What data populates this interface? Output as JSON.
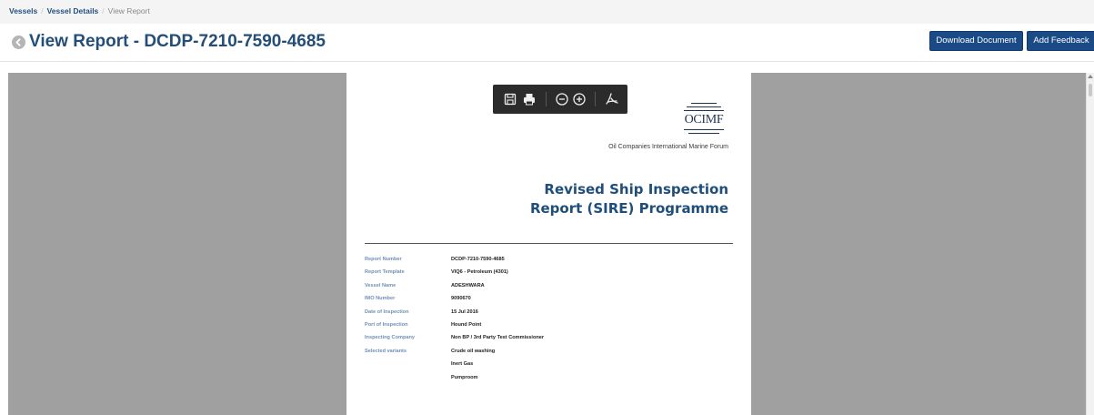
{
  "breadcrumb": {
    "items": [
      "Vessels",
      "Vessel Details"
    ],
    "current": "View Report",
    "separator": "/"
  },
  "header": {
    "title": "View Report - DCDP-7210-7590-4685",
    "download_label": "Download Document",
    "feedback_label": "Add Feedback"
  },
  "viewer_toolbar": {
    "icons": [
      "save-icon",
      "print-icon",
      "zoom-out-icon",
      "zoom-in-icon",
      "pdf-icon"
    ]
  },
  "document": {
    "logo_text": "OCIMF",
    "forum_name": "Oil Companies International Marine Forum",
    "title_line1": "Revised Ship Inspection",
    "title_line2": "Report (SIRE) Programme",
    "details": [
      {
        "label": "Report Number",
        "value": "DCDP-7210-7590-4685"
      },
      {
        "label": "Report Template",
        "value": "VIQ6 - Petroleum (4301)"
      },
      {
        "label": "Vessel Name",
        "value": "ADESHWARA"
      },
      {
        "label": "IMO Number",
        "value": "9090670"
      },
      {
        "label": "Date of Inspection",
        "value": "15 Jul 2016"
      },
      {
        "label": "Port of Inspection",
        "value": "Hound Point"
      },
      {
        "label": "Inspecting Company",
        "value": "Non BP / 3rd Party Test Commissioner"
      },
      {
        "label": "Selected variants",
        "value": "Crude oil washing"
      },
      {
        "label": "",
        "value": "Inert Gas"
      },
      {
        "label": "",
        "value": "Pumproom"
      }
    ]
  },
  "colors": {
    "accent": "#1a4b86",
    "title": "#244e77",
    "doc_title": "#1f4e79",
    "label": "#6f8fb8",
    "viewer_bg": "#a0a0a0"
  }
}
